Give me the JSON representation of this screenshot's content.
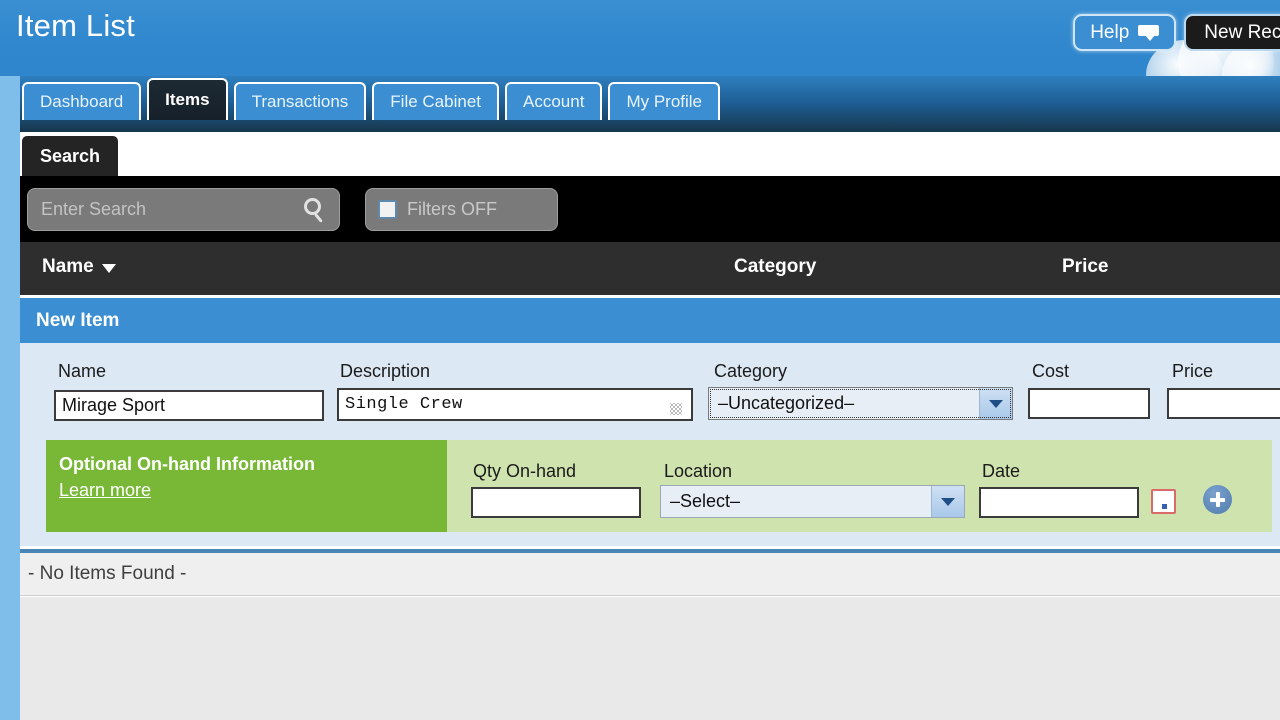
{
  "header": {
    "title": "Item List",
    "help_label": "Help",
    "help_icon": "speech-bubble-icon",
    "new_receipt_label": "New Receipt",
    "cloud_icon": "cloud-graphic"
  },
  "tabs": [
    {
      "label": "Dashboard",
      "active": false
    },
    {
      "label": "Items",
      "active": true
    },
    {
      "label": "Transactions",
      "active": false
    },
    {
      "label": "File Cabinet",
      "active": false
    },
    {
      "label": "Account",
      "active": false
    },
    {
      "label": "My Profile",
      "active": false
    }
  ],
  "search_panel": {
    "tab_label": "Search",
    "search_placeholder": "Enter Search",
    "search_value": "",
    "search_icon": "magnifier-icon",
    "filters_label": "Filters OFF",
    "filters_checked": false,
    "filters_icon": "funnel-icon"
  },
  "columns": {
    "name": "Name",
    "name_sort_icon": "sort-descending-arrow-icon",
    "category": "Category",
    "price": "Price"
  },
  "new_item": {
    "panel_title": "New Item",
    "fields": {
      "name_label": "Name",
      "name_value": "Mirage Sport",
      "description_label": "Description",
      "description_value": "Single Crew",
      "description_resize_icon": "resize-grip-icon",
      "category_label": "Category",
      "category_value": "–Uncategorized–",
      "category_dropdown_icon": "chevron-down-icon",
      "cost_label": "Cost",
      "cost_value": "",
      "price_label": "Price",
      "price_value": ""
    },
    "onhand": {
      "title": "Optional On-hand Information",
      "learn_more": "Learn more",
      "qty_label": "Qty On-hand",
      "qty_value": "",
      "location_label": "Location",
      "location_value": "–Select–",
      "location_dropdown_icon": "chevron-down-icon",
      "date_label": "Date",
      "date_value": "",
      "calendar_icon": "calendar-icon",
      "add_icon": "plus-circle-icon"
    }
  },
  "results": {
    "empty_message": "- No Items Found -"
  },
  "colors": {
    "header_blue": "#3087cd",
    "tab_active_dark": "#16202a",
    "panel_header_blue": "#3a8ed1",
    "form_bg": "#dce8f3",
    "green_dark": "#78b836",
    "green_light": "#cfe3af",
    "search_black": "#000000",
    "col_header_dark": "#2e2e2e"
  }
}
